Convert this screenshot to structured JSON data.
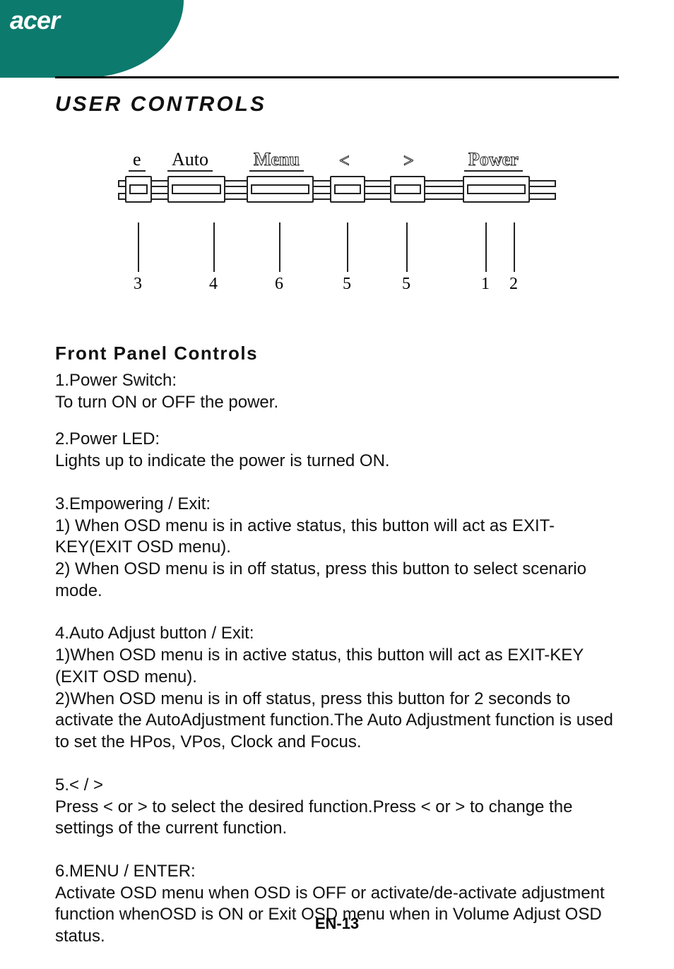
{
  "brand": "acer",
  "section_title": "USER CONTROLS",
  "diagram": {
    "top_labels": {
      "e": "e",
      "auto": "Auto",
      "menu": "Menu",
      "lt": "<",
      "gt": ">",
      "power": "Power"
    },
    "leaders": [
      "3",
      "4",
      "6",
      "5",
      "5",
      "1",
      "2"
    ]
  },
  "subhead": "Front Panel Controls",
  "items": {
    "i1": {
      "title": "1.Power Switch:",
      "lines": [
        "To turn ON or OFF the power."
      ]
    },
    "i2": {
      "title": "2.Power LED:",
      "lines": [
        "Lights up to indicate the power is turned ON."
      ]
    },
    "i3": {
      "title": "3.Empowering / Exit:",
      "lines": [
        "1) When OSD menu is in active status, this button will act as EXIT-KEY(EXIT OSD menu).",
        "2) When OSD menu is in off status, press this button to select scenario mode."
      ]
    },
    "i4": {
      "title": "4.Auto Adjust button / Exit:",
      "lines": [
        "1)When OSD menu is in active status, this button will act as EXIT-KEY (EXIT OSD menu).",
        "2)When OSD menu is in off status, press this button for 2 seconds to activate the AutoAdjustment function.The Auto Adjustment function is used to set the HPos, VPos, Clock and Focus."
      ]
    },
    "i5": {
      "title": "5.< / >",
      "lines": [
        "Press < or  > to select the desired function.Press < or  > to change the settings of the current function."
      ]
    },
    "i6": {
      "title": "6.MENU / ENTER:",
      "lines": [
        "Activate OSD menu when OSD is OFF or activate/de-activate adjustment function whenOSD is ON or Exit OSD menu when in Volume Adjust OSD status."
      ]
    }
  },
  "page_num": "EN-13"
}
